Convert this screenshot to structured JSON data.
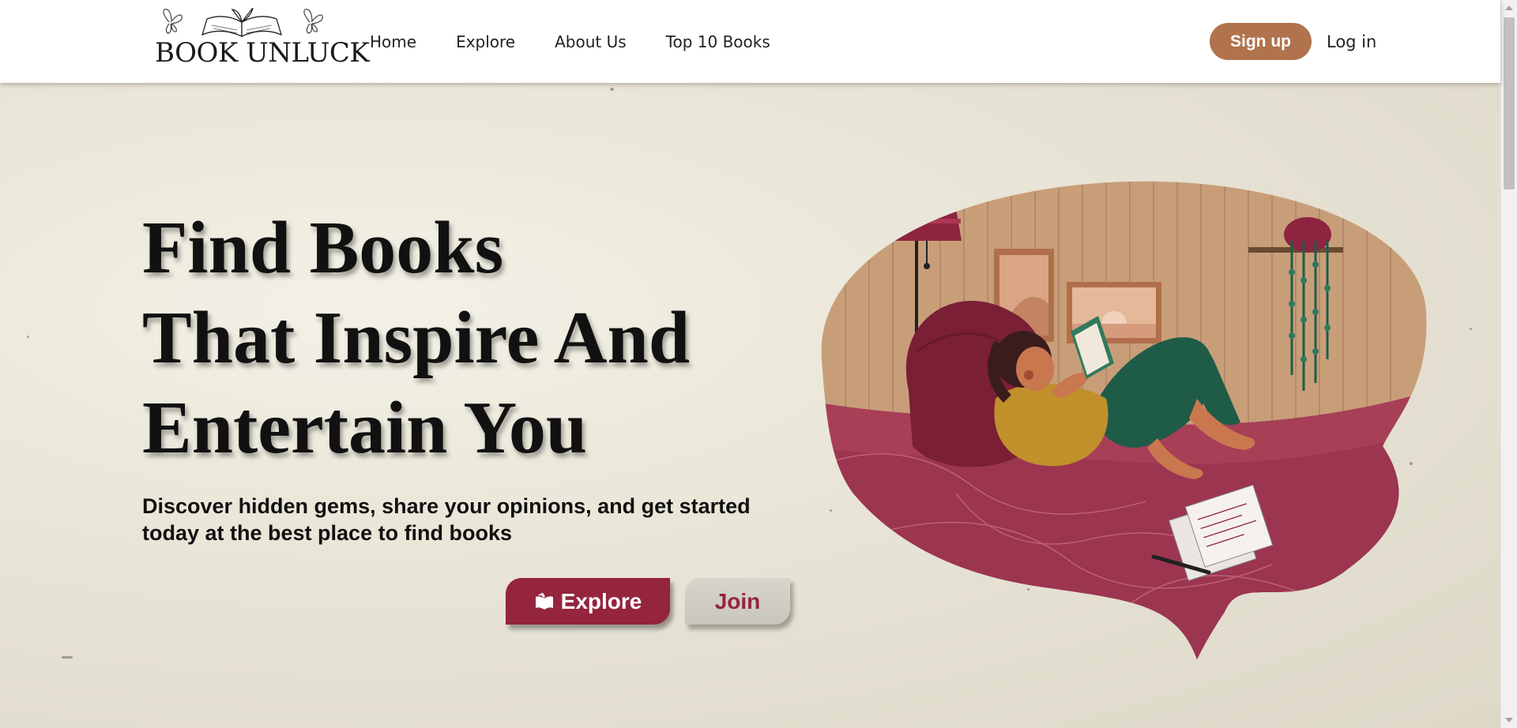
{
  "brand": {
    "logo_text": "BOOK UNLUCK"
  },
  "nav": {
    "links": [
      "Home",
      "Explore",
      "About Us",
      "Top 10 Books"
    ],
    "signup_label": "Sign up",
    "login_label": "Log in"
  },
  "hero": {
    "headline_lines": [
      "Find Books",
      "That Inspire And",
      "Entertain You"
    ],
    "subtext": "Discover hidden gems, share your opinions, and get started today at the best place to find books",
    "explore_label": "Explore",
    "join_label": "Join"
  },
  "colors": {
    "brand_maroon": "#94253d",
    "signup_brown": "#b0734e",
    "paper_background": "#ece8dc"
  },
  "icons": {
    "explore_button_icon": "open-book-icon",
    "illustration": "woman-reading-on-beanbag-illustration"
  }
}
